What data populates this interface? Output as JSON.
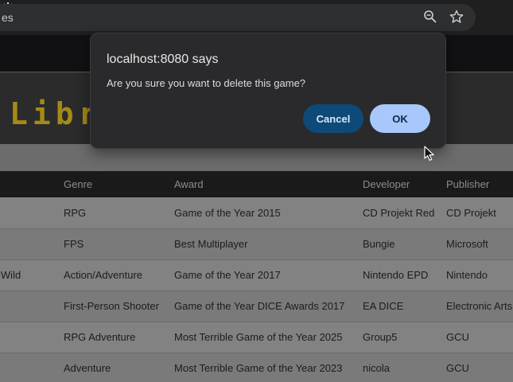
{
  "browser": {
    "address_text": "es",
    "icons": [
      "zoom-icon",
      "star-icon",
      "extension-icon"
    ],
    "extension_color": "#5b5fe6"
  },
  "page": {
    "banner_title": "Libr",
    "banner_color": "#a48a16",
    "table": {
      "headers": [
        "",
        "Genre",
        "Award",
        "Developer",
        "Publisher"
      ],
      "rows": [
        [
          "",
          "RPG",
          "Game of the Year 2015",
          "CD Projekt Red",
          "CD Projekt"
        ],
        [
          "",
          "FPS",
          "Best Multiplayer",
          "Bungie",
          "Microsoft"
        ],
        [
          "f the Wild",
          "Action/Adventure",
          "Game of the Year 2017",
          "Nintendo EPD",
          "Nintendo"
        ],
        [
          "",
          "First-Person Shooter",
          "Game of the Year DICE Awards 2017",
          "EA DICE",
          "Electronic Arts"
        ],
        [
          "",
          "RPG Adventure",
          "Most Terrible Game of the Year 2025",
          "Group5",
          "GCU"
        ],
        [
          "",
          "Adventure",
          "Most Terrible Game of the Year 2023",
          "nicola",
          "GCU"
        ]
      ]
    }
  },
  "dialog": {
    "title": "localhost:8080 says",
    "message": "Are you sure you want to delete this game?",
    "cancel_label": "Cancel",
    "ok_label": "OK",
    "ok_color": "#a8c7fa",
    "cancel_color": "#0d4a7a"
  }
}
